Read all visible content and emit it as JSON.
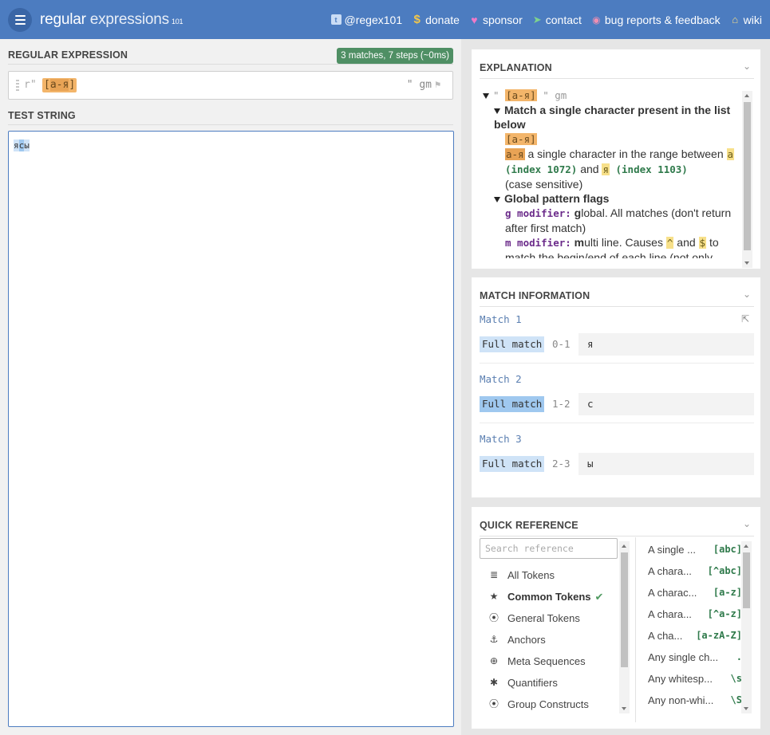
{
  "header": {
    "logo_part1": "regular",
    "logo_part2": "expressions",
    "logo_part3": "101",
    "nav": [
      {
        "label": "@regex101",
        "icon": "twitter-icon"
      },
      {
        "label": "donate",
        "icon": "dollar-icon"
      },
      {
        "label": "sponsor",
        "icon": "heart-icon"
      },
      {
        "label": "contact",
        "icon": "paper-plane-icon"
      },
      {
        "label": "bug reports & feedback",
        "icon": "bug-icon"
      },
      {
        "label": "wiki",
        "icon": "library-icon"
      }
    ]
  },
  "regex": {
    "section_label": "REGULAR EXPRESSION",
    "badge": "3 matches, 7 steps (~0ms)",
    "delim_open": "r\"",
    "pattern_open": "[",
    "pattern_range": "а-я",
    "pattern_close": "]",
    "flags": "\" gm"
  },
  "test": {
    "section_label": "TEST STRING",
    "chars": [
      "я",
      "с",
      "ы"
    ]
  },
  "explanation": {
    "title": "EXPLANATION",
    "root_quote_open": "\" ",
    "root_pattern": "[а-я]",
    "root_quote_close": " \" gm",
    "match_heading": "Match a single character present in the list below",
    "class_token": "[а-я]",
    "range_token": "а-я",
    "range_text": " a single character in the range between ",
    "from_char": "а",
    "from_index": " (index 1072)",
    "and_text": " and ",
    "to_char": "я",
    "to_index": " (index 1103)",
    "case_text": "(case sensitive)",
    "flags_heading": "Global pattern flags",
    "g_mod": "g modifier:",
    "g_bold": " g",
    "g_text": "lobal. All matches (don't return after first match)",
    "m_mod": "m modifier:",
    "m_bold": " m",
    "m_text1": "ulti line. Causes ",
    "caret": "^",
    "m_and": " and ",
    "dollar": "$",
    "m_text2": " to match the begin/end of each line (not only begin/end of string)"
  },
  "match_info": {
    "title": "MATCH INFORMATION",
    "matches": [
      {
        "label": "Match 1",
        "type": "Full match",
        "range": "0-1",
        "value": "я"
      },
      {
        "label": "Match 2",
        "type": "Full match",
        "range": "1-2",
        "value": "с"
      },
      {
        "label": "Match 3",
        "type": "Full match",
        "range": "2-3",
        "value": "ы"
      }
    ]
  },
  "quick_reference": {
    "title": "QUICK REFERENCE",
    "search_placeholder": "Search reference",
    "categories": [
      {
        "label": "All Tokens",
        "icon": "database-icon"
      },
      {
        "label": "Common Tokens",
        "icon": "star-icon",
        "active": true
      },
      {
        "label": "General Tokens",
        "icon": "target-icon"
      },
      {
        "label": "Anchors",
        "icon": "anchor-icon"
      },
      {
        "label": "Meta Sequences",
        "icon": "lifebuoy-icon"
      },
      {
        "label": "Quantifiers",
        "icon": "asterisk-icon"
      },
      {
        "label": "Group Constructs",
        "icon": "target-icon"
      }
    ],
    "tokens": [
      {
        "desc": "A single ...",
        "code": "[abc]"
      },
      {
        "desc": "A chara...",
        "code": "[^abc]"
      },
      {
        "desc": "A charac...",
        "code": "[a-z]"
      },
      {
        "desc": "A chara...",
        "code": "[^a-z]"
      },
      {
        "desc": "A cha...",
        "code": "[a-zA-Z]"
      },
      {
        "desc": "Any single ch...",
        "code": "."
      },
      {
        "desc": "Any whitesp...",
        "code": "\\s"
      },
      {
        "desc": "Any non-whi...",
        "code": "\\S"
      }
    ]
  }
}
